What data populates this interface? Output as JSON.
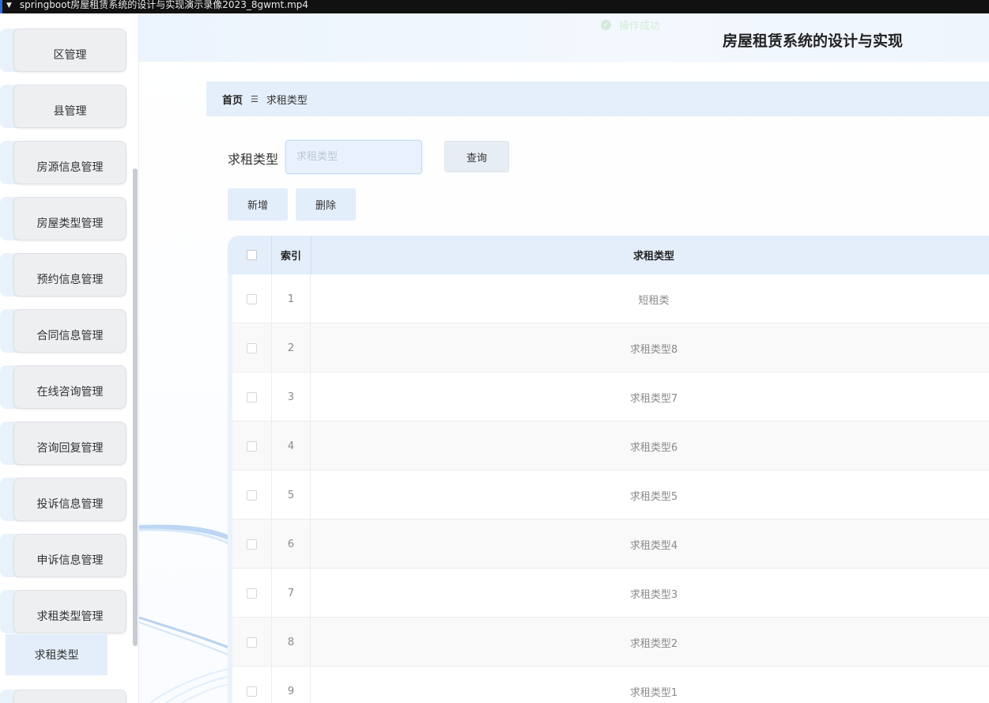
{
  "window": {
    "title": "springboot房屋租赁系统的设计与实现演示录像2023_8gwmt.mp4"
  },
  "header": {
    "title": "房屋租赁系统的设计与实现",
    "toast": "操作成功"
  },
  "sidebar": {
    "items": [
      {
        "label": "区管理"
      },
      {
        "label": "县管理"
      },
      {
        "label": "房源信息管理"
      },
      {
        "label": "房屋类型管理"
      },
      {
        "label": "预约信息管理"
      },
      {
        "label": "合同信息管理"
      },
      {
        "label": "在线咨询管理"
      },
      {
        "label": "咨询回复管理"
      },
      {
        "label": "投诉信息管理"
      },
      {
        "label": "申诉信息管理"
      },
      {
        "label": "求租类型管理"
      }
    ],
    "sub_item": "求租类型"
  },
  "breadcrumb": {
    "home": "首页",
    "separator": "☰",
    "current": "求租类型"
  },
  "search": {
    "label": "求租类型",
    "placeholder": "求租类型",
    "button": "查询"
  },
  "actions": {
    "add": "新增",
    "delete": "删除"
  },
  "table": {
    "columns": {
      "index": "索引",
      "type": "求租类型"
    },
    "rows": [
      {
        "index": "1",
        "type": "短租类"
      },
      {
        "index": "2",
        "type": "求租类型8"
      },
      {
        "index": "3",
        "type": "求租类型7"
      },
      {
        "index": "4",
        "type": "求租类型6"
      },
      {
        "index": "5",
        "type": "求租类型5"
      },
      {
        "index": "6",
        "type": "求租类型4"
      },
      {
        "index": "7",
        "type": "求租类型3"
      },
      {
        "index": "8",
        "type": "求租类型2"
      },
      {
        "index": "9",
        "type": "求租类型1"
      }
    ]
  },
  "colors": {
    "accent": "#e4eefb",
    "header_bg": "#ecf4fd",
    "titlebar_bg": "#111111"
  }
}
